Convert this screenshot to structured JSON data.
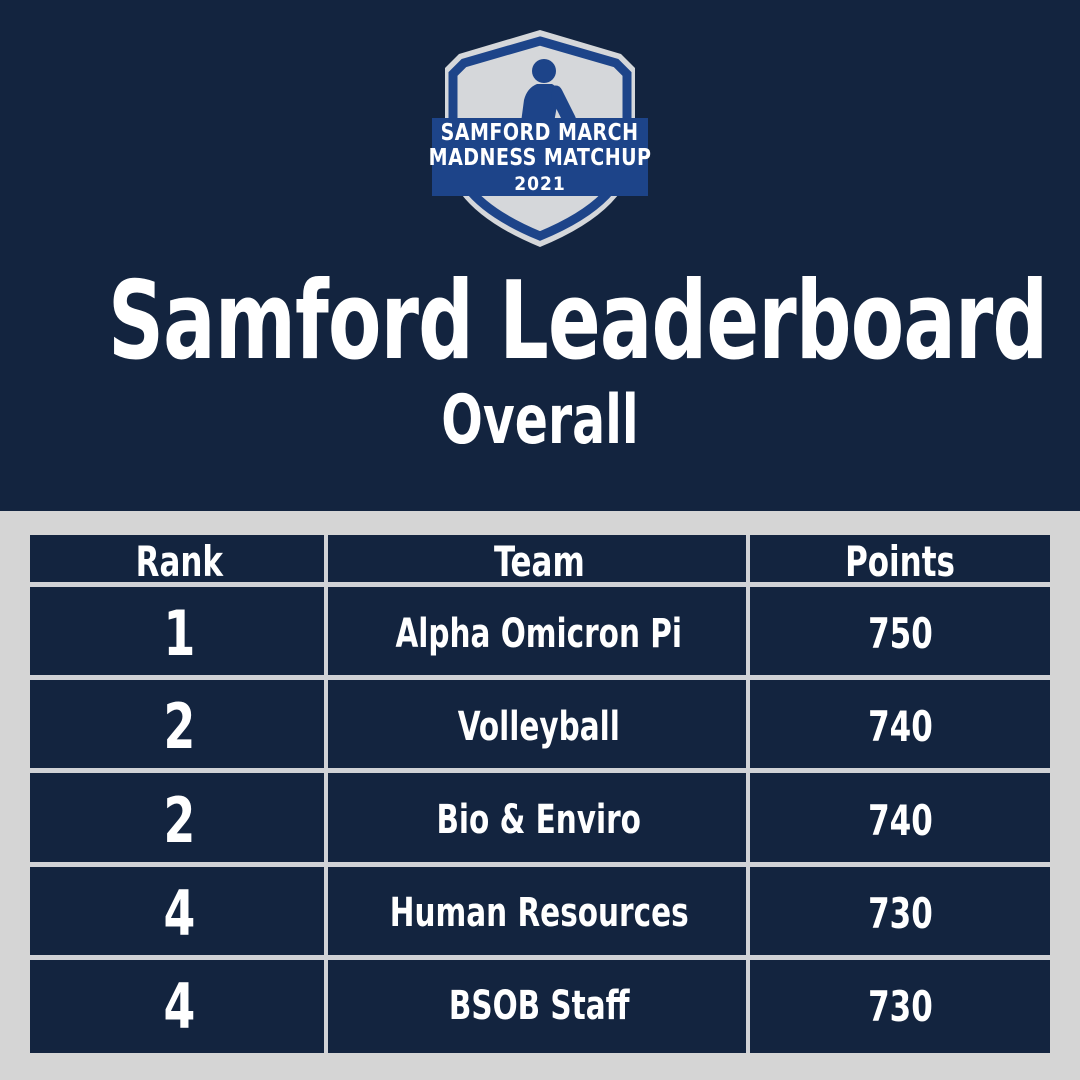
{
  "colors": {
    "navy": "#13243f",
    "banner_blue": "#1d4489",
    "light_gray": "#d5d5d5",
    "line_gray": "#d0d2d6",
    "white": "#ffffff"
  },
  "logo": {
    "icon": "shield-basketball-player-icon",
    "banner_line1": "SAMFORD MARCH",
    "banner_line2": "MADNESS MATCHUP",
    "year": "2021"
  },
  "header": {
    "title": "Samford Leaderboard",
    "subtitle": "Overall"
  },
  "table": {
    "columns": [
      "Rank",
      "Team",
      "Points"
    ],
    "rows": [
      {
        "rank": "1",
        "team": "Alpha Omicron Pi",
        "points": "750"
      },
      {
        "rank": "2",
        "team": "Volleyball",
        "points": "740"
      },
      {
        "rank": "2",
        "team": "Bio & Enviro",
        "points": "740"
      },
      {
        "rank": "4",
        "team": "Human Resources",
        "points": "730"
      },
      {
        "rank": "4",
        "team": "BSOB Staff",
        "points": "730"
      }
    ]
  }
}
